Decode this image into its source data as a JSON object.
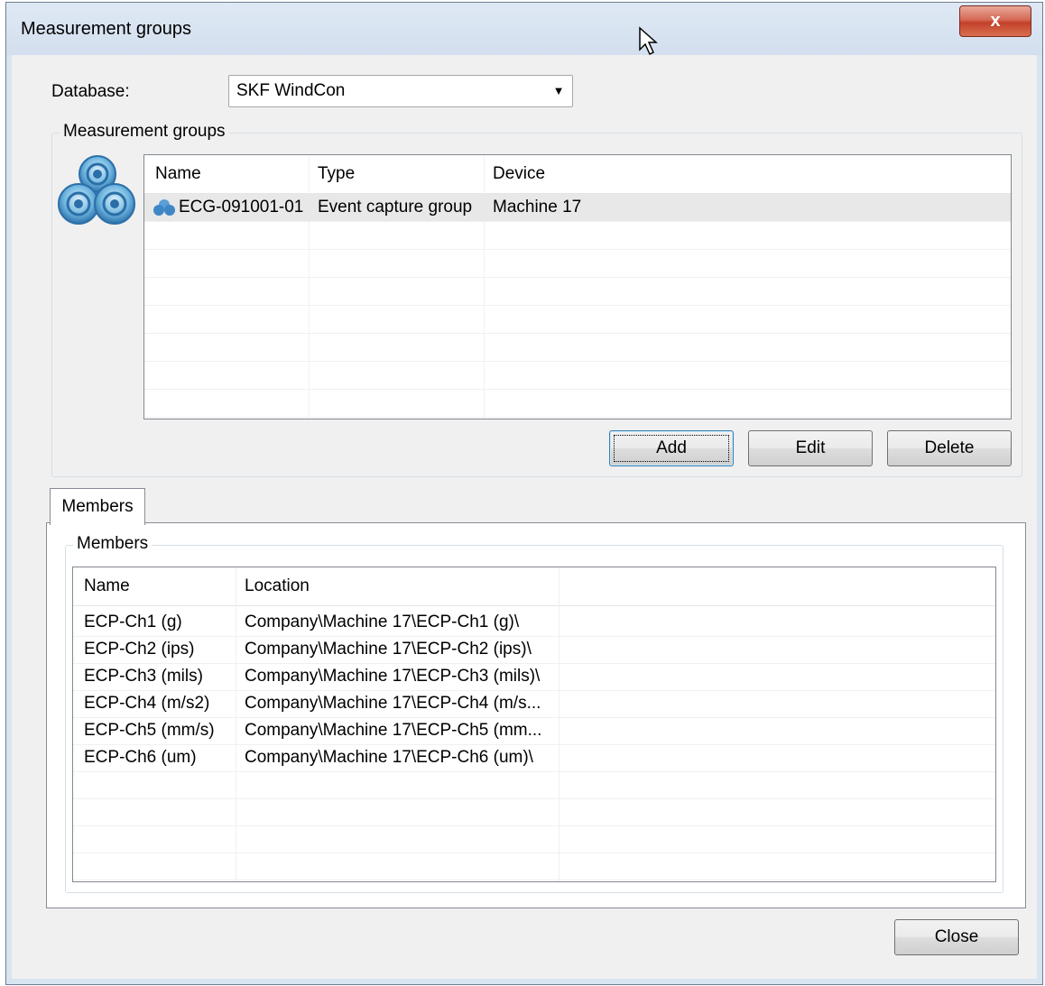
{
  "window": {
    "title": "Measurement groups",
    "close_label": "x"
  },
  "database": {
    "label": "Database:",
    "value": "SKF WindCon"
  },
  "groups": {
    "legend": "Measurement groups",
    "columns": [
      "Name",
      "Type",
      "Device"
    ],
    "rows": [
      {
        "name": "ECG-091001-01",
        "type": "Event capture group",
        "device": "Machine 17",
        "selected": true
      }
    ],
    "buttons": {
      "add": "Add",
      "edit": "Edit",
      "delete": "Delete"
    }
  },
  "tabs": {
    "members": "Members"
  },
  "members": {
    "legend": "Members",
    "columns": [
      "Name",
      "Location"
    ],
    "rows": [
      {
        "name": "ECP-Ch1 (g)",
        "location": "Company\\Machine 17\\ECP-Ch1 (g)\\"
      },
      {
        "name": "ECP-Ch2 (ips)",
        "location": "Company\\Machine 17\\ECP-Ch2 (ips)\\"
      },
      {
        "name": "ECP-Ch3 (mils)",
        "location": "Company\\Machine 17\\ECP-Ch3 (mils)\\"
      },
      {
        "name": "ECP-Ch4 (m/s2)",
        "location": "Company\\Machine 17\\ECP-Ch4 (m/s..."
      },
      {
        "name": "ECP-Ch5 (mm/s)",
        "location": "Company\\Machine 17\\ECP-Ch5 (mm..."
      },
      {
        "name": "ECP-Ch6 (um)",
        "location": "Company\\Machine 17\\ECP-Ch6 (um)\\"
      }
    ]
  },
  "footer": {
    "close": "Close"
  },
  "colors": {
    "selected_row": "#e8e8e8",
    "window_bg": "#f0f0f0",
    "close_button": "#c3402a"
  },
  "icons": {
    "group_logo": "measurement-groups-logo-icon",
    "row_icon": "group-cloud-icon",
    "dropdown": "chevron-down-icon"
  }
}
